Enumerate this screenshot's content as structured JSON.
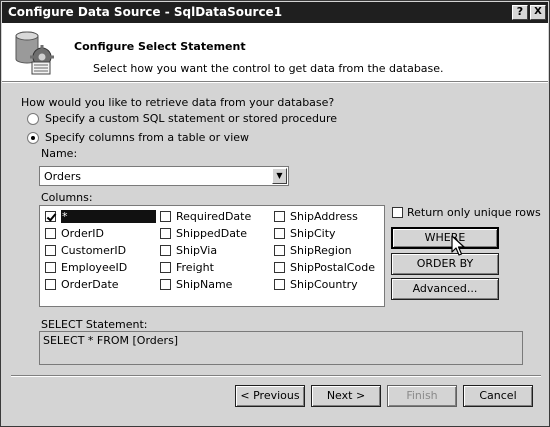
{
  "window": {
    "title": "Configure Data Source - SqlDataSource1",
    "help_label": "?",
    "close_label": "X"
  },
  "header": {
    "title": "Configure Select Statement",
    "subtitle": "Select how you want the control to get data from the database."
  },
  "question": "How would you like to retrieve data from your database?",
  "options": [
    {
      "label": "Specify a custom SQL statement or stored procedure",
      "checked": false
    },
    {
      "label": "Specify columns from a table or view",
      "checked": true
    }
  ],
  "name_field": {
    "label": "Name:",
    "value": "Orders"
  },
  "columns": {
    "label": "Columns:",
    "items": [
      {
        "label": "*",
        "checked": true
      },
      {
        "label": "OrderID",
        "checked": false
      },
      {
        "label": "CustomerID",
        "checked": false
      },
      {
        "label": "EmployeeID",
        "checked": false
      },
      {
        "label": "OrderDate",
        "checked": false
      },
      {
        "label": "RequiredDate",
        "checked": false
      },
      {
        "label": "ShippedDate",
        "checked": false
      },
      {
        "label": "ShipVia",
        "checked": false
      },
      {
        "label": "Freight",
        "checked": false
      },
      {
        "label": "ShipName",
        "checked": false
      },
      {
        "label": "ShipAddress",
        "checked": false
      },
      {
        "label": "ShipCity",
        "checked": false
      },
      {
        "label": "ShipRegion",
        "checked": false
      },
      {
        "label": "ShipPostalCode",
        "checked": false
      },
      {
        "label": "ShipCountry",
        "checked": false
      }
    ]
  },
  "unique_rows_label": "Return only unique rows",
  "buttons": {
    "where": "WHERE",
    "order_by": "ORDER BY",
    "advanced": "Advanced..."
  },
  "select_statement": {
    "label": "SELECT Statement:",
    "value": "SELECT * FROM [Orders]"
  },
  "footer": {
    "previous": "< Previous",
    "next": "Next >",
    "finish": "Finish",
    "cancel": "Cancel"
  },
  "icons": {
    "header": "database-gear-icon",
    "cursor": "mouse-pointer-icon"
  }
}
